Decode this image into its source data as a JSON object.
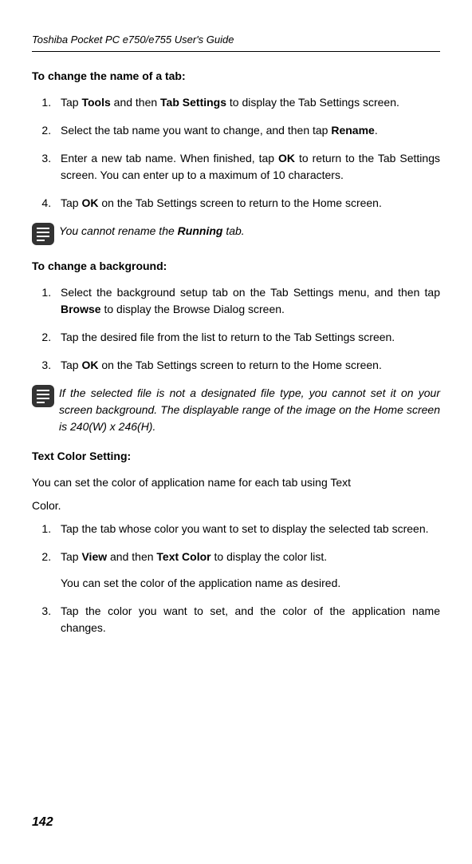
{
  "header": "Toshiba Pocket PC e750/e755  User's Guide",
  "sections": {
    "tab_rename": {
      "heading": "To change the name of a tab:",
      "steps": [
        "Tap <strong>Tools</strong> and then <strong>Tab Settings</strong> to display the Tab Settings screen.",
        "Select the tab name you want to change, and then tap <strong>Rename</strong>.",
        "Enter a new tab name. When finished, tap <strong>OK</strong> to return to the Tab Settings screen. You can enter up to a maximum of 10 characters.",
        "Tap <strong>OK</strong> on the Tab Settings screen to return to the Home screen."
      ],
      "note": "You cannot rename the <em class=\"b\">Running</em> tab."
    },
    "background": {
      "heading": "To change a background:",
      "steps": [
        "Select the background setup tab on the Tab Settings menu, and then tap <strong>Browse</strong> to display the Browse Dialog screen.",
        "Tap the desired file from the list to return to the Tab Settings screen.",
        "Tap <strong>OK</strong> on the Tab Settings screen to return to the Home screen."
      ],
      "note": "If the selected file is not a designated file type, you cannot set it on your screen background. The displayable range of the image on the Home screen is 240(W) x 246(H)."
    },
    "text_color": {
      "heading": "Text Color Setting:",
      "intro1": "You can set the color of application name for each tab using Text",
      "intro2": "Color.",
      "steps": [
        "Tap the tab whose color you want to set to display the selected tab screen.",
        "Tap <strong>View</strong> and then <strong>Text Color</strong> to display the color list.",
        "Tap the color you want to set, and the color of the application name changes."
      ],
      "step2_extra": "You can set the color of the application name as desired."
    }
  },
  "page_number": "142"
}
